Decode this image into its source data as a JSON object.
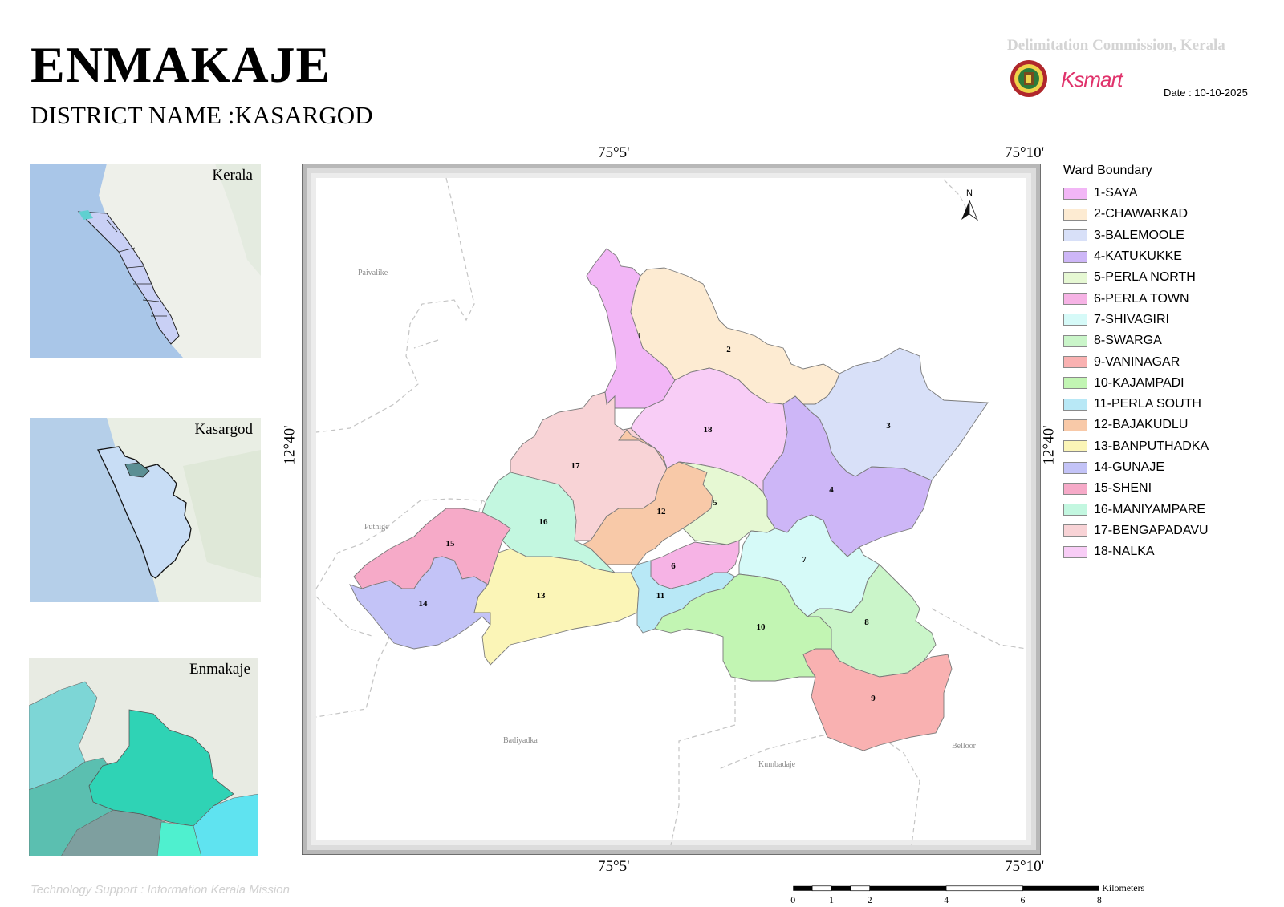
{
  "header": {
    "title": "ENMAKAJE",
    "district": "DISTRICT NAME :KASARGOD",
    "commission": "Delimitation Commission, Kerala",
    "date": "Date : 10-10-2025",
    "ksmart_logo_text": "Ksmart",
    "seal_icon": "election-commission-seal-icon"
  },
  "insets": [
    {
      "label": "Kerala"
    },
    {
      "label": "Kasargod"
    },
    {
      "label": "Enmakaje"
    }
  ],
  "coordinates": {
    "lon_left": "75°5'",
    "lon_right": "75°10'",
    "lat": "12°40'"
  },
  "map": {
    "north_label": "N",
    "places": [
      "Paivalike",
      "Puthige",
      "Badiyadka",
      "Kumbadaje",
      "Belloor"
    ]
  },
  "legend": {
    "title": "Ward Boundary",
    "items": [
      {
        "num": "1",
        "label": "1-SAYA",
        "color": "#f2b6f6"
      },
      {
        "num": "2",
        "label": "2-CHAWARKAD",
        "color": "#fdebd2"
      },
      {
        "num": "3",
        "label": "3-BALEMOOLE",
        "color": "#d8e0f8"
      },
      {
        "num": "4",
        "label": "4-KATUKUKKE",
        "color": "#cdb6f7"
      },
      {
        "num": "5",
        "label": "5-PERLA NORTH",
        "color": "#e6f8d3"
      },
      {
        "num": "6",
        "label": "6-PERLA TOWN",
        "color": "#f6b3e5"
      },
      {
        "num": "7",
        "label": "7-SHIVAGIRI",
        "color": "#d6faf8"
      },
      {
        "num": "8",
        "label": "8-SWARGA",
        "color": "#caf5c9"
      },
      {
        "num": "9",
        "label": "9-VANINAGAR",
        "color": "#f9b1b1"
      },
      {
        "num": "10",
        "label": "10-KAJAMPADI",
        "color": "#c2f5b3"
      },
      {
        "num": "11",
        "label": "11-PERLA SOUTH",
        "color": "#b8e8f6"
      },
      {
        "num": "12",
        "label": "12-BAJAKUDLU",
        "color": "#f8c9a8"
      },
      {
        "num": "13",
        "label": "13-BANPUTHADKA",
        "color": "#fbf5b7"
      },
      {
        "num": "14",
        "label": "14-GUNAJE",
        "color": "#c3c3f7"
      },
      {
        "num": "15",
        "label": "15-SHENI",
        "color": "#f6aac8"
      },
      {
        "num": "16",
        "label": "16-MANIYAMPARE",
        "color": "#c3f7e0"
      },
      {
        "num": "17",
        "label": "17-BENGAPADAVU",
        "color": "#f8d3d6"
      },
      {
        "num": "18",
        "label": "18-NALKA",
        "color": "#f8cdf6"
      }
    ]
  },
  "scale": {
    "unit": "Kilometers",
    "ticks": [
      "0",
      "1",
      "2",
      "4",
      "6",
      "8"
    ]
  },
  "footer": "Technology Support : Information Kerala Mission"
}
